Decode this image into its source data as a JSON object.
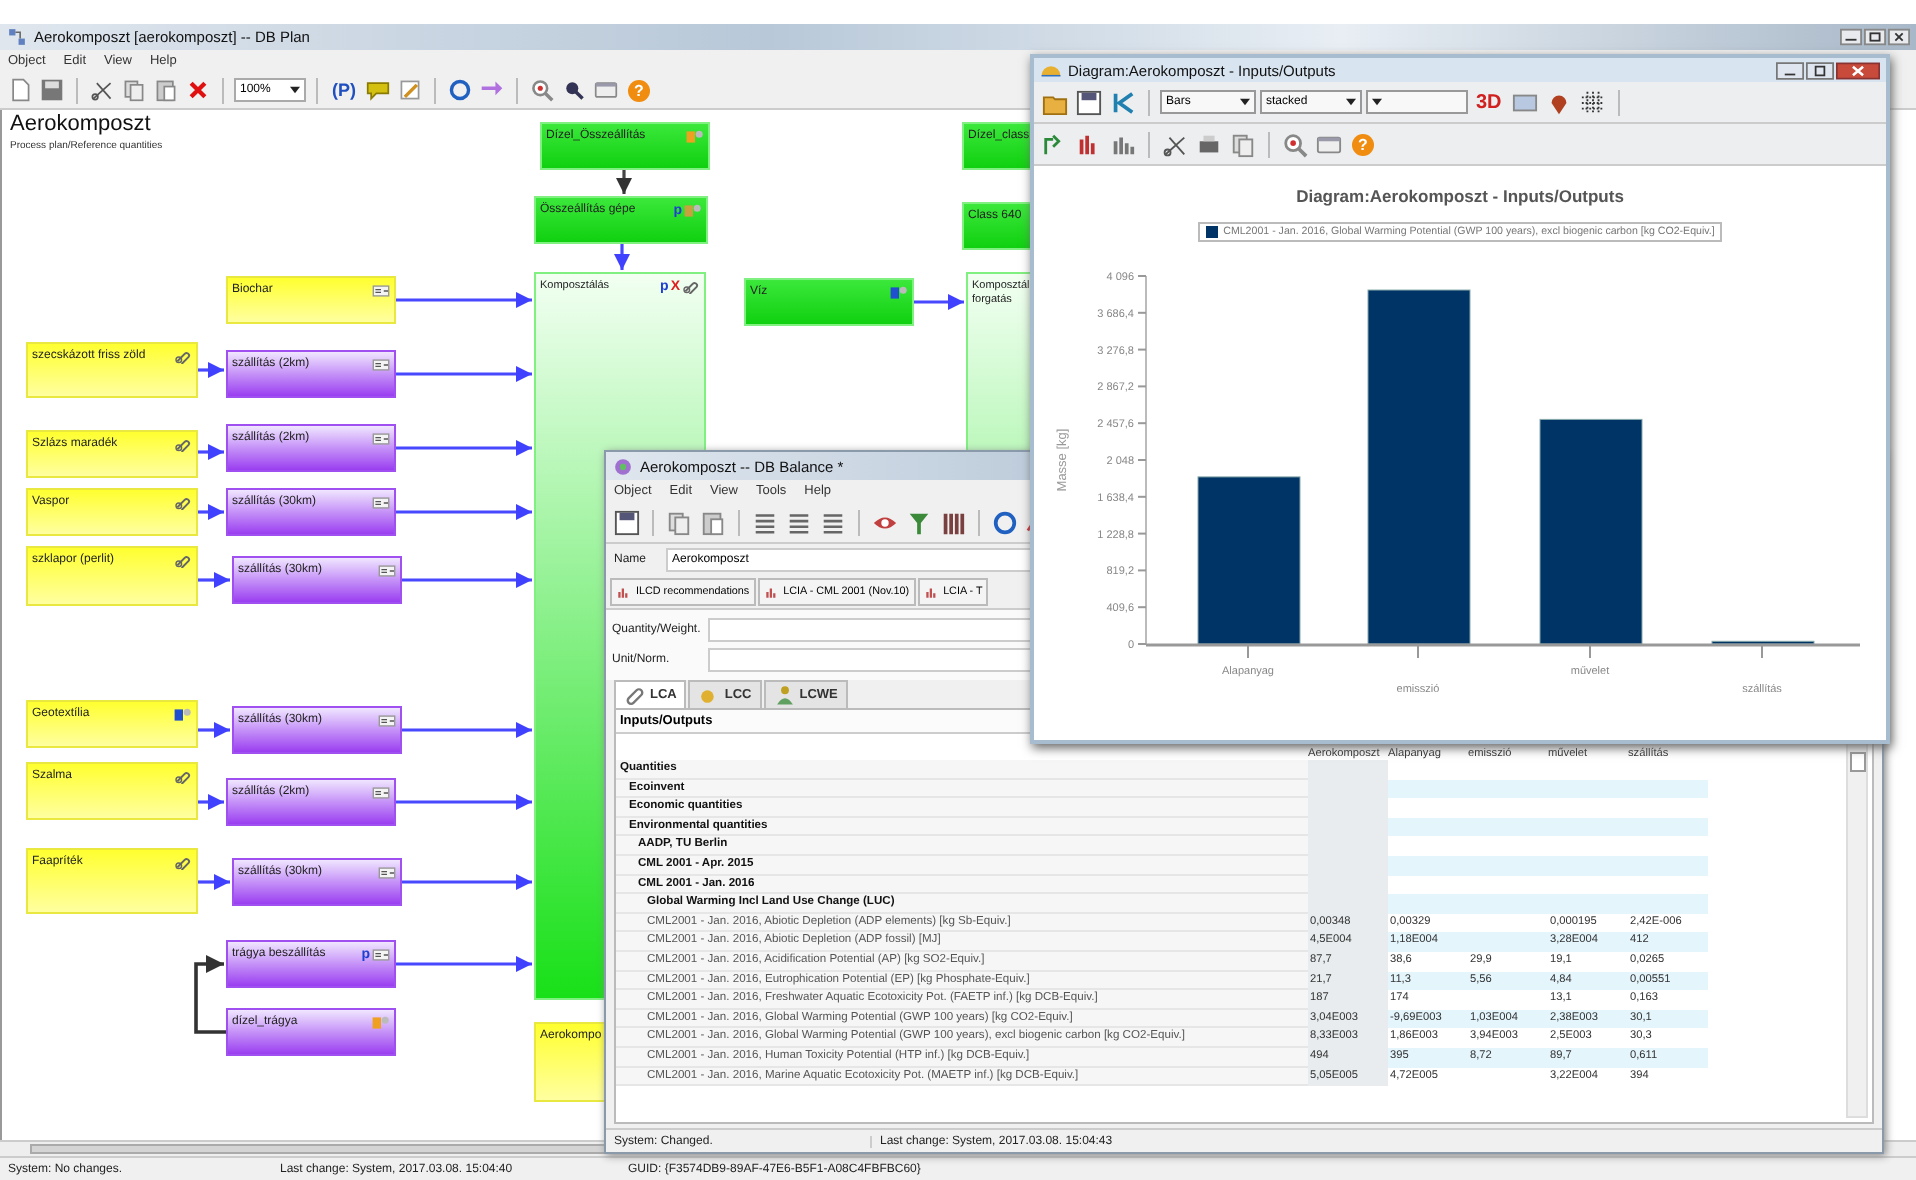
{
  "main_window": {
    "title": "Aerokomposzt [aerokomposzt] -- DB Plan",
    "menu": [
      "Object",
      "Edit",
      "View",
      "Help"
    ],
    "zoom": "100%",
    "p_button": "(P)",
    "help": "?"
  },
  "plan": {
    "title": "Aerokomposzt",
    "subtitle": "Process plan/Reference quantities",
    "nodes": [
      {
        "label": "Dízel_Összeállítás",
        "kind": "green",
        "marks": [
          {
            "kind": "doc",
            "color": "#f0a020"
          }
        ]
      },
      {
        "label": "Összeállítás gépe",
        "kind": "green",
        "marks": [
          {
            "kind": "letter",
            "text": "p",
            "color": "#2040d0"
          },
          {
            "kind": "doc",
            "color": "#c8a040"
          }
        ]
      },
      {
        "label": "Komposztálás",
        "kind": "green-tall",
        "marks": [
          {
            "kind": "letter",
            "text": "p",
            "color": "#2040d0"
          },
          {
            "kind": "letter",
            "text": "X",
            "color": "#e02020"
          },
          {
            "kind": "link"
          }
        ]
      },
      {
        "label": "Víz",
        "kind": "green",
        "marks": [
          {
            "kind": "doc",
            "color": "#2050d0"
          }
        ]
      },
      {
        "label": "Dízel_class",
        "kind": "green"
      },
      {
        "label": "Class 640",
        "kind": "green"
      },
      {
        "label": "Komposztál forgatás",
        "kind": "green-tall"
      },
      {
        "label": "Aerokompo",
        "kind": "yellow"
      },
      {
        "label": "Biochar",
        "kind": "yellow",
        "marks": [
          {
            "kind": "flow"
          }
        ]
      },
      {
        "label": "szecskázott friss zöld",
        "kind": "yellow",
        "marks": [
          {
            "kind": "link"
          }
        ]
      },
      {
        "label": "Szlázs maradék",
        "kind": "yellow",
        "marks": [
          {
            "kind": "link"
          }
        ]
      },
      {
        "label": "Vaspor",
        "kind": "yellow",
        "marks": [
          {
            "kind": "link"
          }
        ]
      },
      {
        "label": "szklapor (perlit)",
        "kind": "yellow",
        "marks": [
          {
            "kind": "link"
          }
        ]
      },
      {
        "label": "Geotextília",
        "kind": "yellow",
        "marks": [
          {
            "kind": "doc",
            "color": "#2050d0"
          }
        ]
      },
      {
        "label": "Szalma",
        "kind": "yellow",
        "marks": [
          {
            "kind": "link"
          }
        ]
      },
      {
        "label": "Faapríték",
        "kind": "yellow",
        "marks": [
          {
            "kind": "link"
          }
        ]
      },
      {
        "label": "szállítás (2km)",
        "kind": "purple",
        "marks": [
          {
            "kind": "flow"
          }
        ]
      },
      {
        "label": "szállítás (2km)",
        "kind": "purple",
        "marks": [
          {
            "kind": "flow"
          }
        ]
      },
      {
        "label": "szállítás (30km)",
        "kind": "purple",
        "marks": [
          {
            "kind": "flow"
          }
        ]
      },
      {
        "label": "szállítás (30km)",
        "kind": "purple",
        "marks": [
          {
            "kind": "flow"
          }
        ]
      },
      {
        "label": "szállítás (30km)",
        "kind": "purple",
        "marks": [
          {
            "kind": "flow"
          }
        ]
      },
      {
        "label": "szállítás (2km)",
        "kind": "purple",
        "marks": [
          {
            "kind": "flow"
          }
        ]
      },
      {
        "label": "szállítás (30km)",
        "kind": "purple",
        "marks": [
          {
            "kind": "flow"
          }
        ]
      },
      {
        "label": "trágya beszállítás",
        "kind": "purple",
        "marks": [
          {
            "kind": "letter",
            "text": "p",
            "color": "#2040d0"
          },
          {
            "kind": "flow"
          }
        ]
      },
      {
        "label": "dízel_trágya",
        "kind": "purple",
        "marks": [
          {
            "kind": "doc",
            "color": "#f0a020"
          }
        ]
      }
    ]
  },
  "status_bar": [
    "System: No changes.",
    "Last change: System, 2017.03.08. 15:04:40",
    "GUID: {F3574DB9-89AF-47E6-B5F1-A08C4FBFBC60}"
  ],
  "balance_window": {
    "title": "Aerokomposzt -- DB Balance *",
    "menu": [
      "Object",
      "Edit",
      "View",
      "Tools",
      "Help"
    ],
    "name_label": "Name",
    "name_value": "Aerokomposzt",
    "method_tabs": [
      "ILCD recommendations",
      "LCIA - CML 2001 (Nov.10)",
      "LCIA - T"
    ],
    "fields": [
      "Quantity/Weight.",
      "Unit/Norm."
    ],
    "tabs": [
      {
        "label": "LCA",
        "selected": true
      },
      {
        "label": "LCC",
        "selected": false
      },
      {
        "label": "LCWE",
        "selected": false
      }
    ],
    "table": {
      "header": "Inputs/Outputs",
      "columns": [
        "Aerokomposzt",
        "Alapanyag",
        "emisszió",
        "művelet",
        "szállítás"
      ],
      "rows": [
        {
          "label": "Quantities",
          "kind": "group",
          "children": [
            {
              "label": "Ecoinvent",
              "kind": "group"
            },
            {
              "label": "Economic quantities",
              "kind": "group"
            },
            {
              "label": "Environmental quantities",
              "kind": "group",
              "children": [
                {
                  "label": "AADP, TU Berlin",
                  "kind": "group"
                },
                {
                  "label": "CML 2001 - Apr. 2015",
                  "kind": "group"
                },
                {
                  "label": "CML 2001 - Jan. 2016",
                  "kind": "group",
                  "children": [
                    {
                      "label": "Global Warming Incl Land Use Change (LUC)",
                      "kind": "group"
                    },
                    {
                      "label": "CML2001 - Jan. 2016, Abiotic Depletion (ADP elements) [kg Sb-Equiv.]",
                      "kind": "value",
                      "values": {
                        "col_1": "0,00348",
                        "col_2": "0,00329",
                        "col_4": "0,000195",
                        "col_5": "2,42E-006"
                      }
                    },
                    {
                      "label": "CML2001 - Jan. 2016, Abiotic Depletion (ADP fossil) [MJ]",
                      "kind": "value",
                      "values": {
                        "col_1": "4,5E004",
                        "col_2": "1,18E004",
                        "col_4": "3,28E004",
                        "col_5": "412"
                      }
                    },
                    {
                      "label": "CML2001 - Jan. 2016, Acidification Potential (AP) [kg SO2-Equiv.]",
                      "kind": "value",
                      "values": {
                        "col_1": "87,7",
                        "col_2": "38,6",
                        "col_3": "29,9",
                        "col_4": "19,1",
                        "col_5": "0,0265"
                      }
                    },
                    {
                      "label": "CML2001 - Jan. 2016, Eutrophication Potential (EP) [kg Phosphate-Equiv.]",
                      "kind": "value",
                      "values": {
                        "col_1": "21,7",
                        "col_2": "11,3",
                        "col_3": "5,56",
                        "col_4": "4,84",
                        "col_5": "0,00551"
                      }
                    },
                    {
                      "label": "CML2001 - Jan. 2016, Freshwater Aquatic Ecotoxicity Pot. (FAETP inf.) [kg DCB-Equiv.]",
                      "kind": "value",
                      "values": {
                        "col_1": "187",
                        "col_2": "174",
                        "col_4": "13,1",
                        "col_5": "0,163"
                      }
                    },
                    {
                      "label": "CML2001 - Jan. 2016, Global Warming Potential (GWP 100 years) [kg CO2-Equiv.]",
                      "kind": "value",
                      "values": {
                        "col_1": "3,04E003",
                        "col_2": "-9,69E003",
                        "col_3": "1,03E004",
                        "col_4": "2,38E003",
                        "col_5": "30,1"
                      }
                    },
                    {
                      "label": "CML2001 - Jan. 2016, Global Warming Potential (GWP 100 years), excl biogenic carbon [kg CO2-Equiv.]",
                      "kind": "value",
                      "values": {
                        "col_1": "8,33E003",
                        "col_2": "1,86E003",
                        "col_3": "3,94E003",
                        "col_4": "2,5E003",
                        "col_5": "30,3"
                      }
                    },
                    {
                      "label": "CML2001 - Jan. 2016, Human Toxicity Potential (HTP inf.) [kg DCB-Equiv.]",
                      "kind": "value",
                      "values": {
                        "col_1": "494",
                        "col_2": "395",
                        "col_3": "8,72",
                        "col_4": "89,7",
                        "col_5": "0,611"
                      }
                    },
                    {
                      "label": "CML2001 - Jan. 2016, Marine Aquatic Ecotoxicity Pot. (MAETP inf.) [kg DCB-Equiv.]",
                      "kind": "value",
                      "values": {
                        "col_1": "5,05E005",
                        "col_2": "4,72E005",
                        "col_4": "3,22E004",
                        "col_5": "394"
                      }
                    }
                  ]
                }
              ]
            }
          ]
        }
      ]
    },
    "status_bar": [
      "System: Changed.",
      "Last change: System, 2017.03.08. 15:04:43"
    ]
  },
  "diagram_window": {
    "title": "Diagram:Aerokomposzt - Inputs/Outputs",
    "chart_type": "Bars",
    "mode": "stacked",
    "three_d": "3D",
    "help": "?",
    "chart_data": {
      "type": "bar",
      "title": "Diagram:Aerokomposzt - Inputs/Outputs",
      "ylabel": "Masse [kg]",
      "categories": [
        "Alapanyag",
        "emisszió",
        "művelet",
        "szállítás"
      ],
      "series": [
        {
          "name": "CML2001 - Jan. 2016, Global Warming Potential (GWP 100 years), excl biogenic carbon [kg CO2-Equiv.]",
          "color": "#003366",
          "values": [
            1860,
            3940,
            2500,
            30
          ]
        }
      ],
      "ylim": [
        0,
        4096
      ],
      "yticks": [
        {
          "value": 0,
          "label": "0"
        },
        {
          "value": 409.6,
          "label": "409,6"
        },
        {
          "value": 819.2,
          "label": "819,2"
        },
        {
          "value": 1228.8,
          "label": "1 228,8"
        },
        {
          "value": 1638.4,
          "label": "1 638,4"
        },
        {
          "value": 2048,
          "label": "2 048"
        },
        {
          "value": 2457.6,
          "label": "2 457,6"
        },
        {
          "value": 2867.2,
          "label": "2 867,2"
        },
        {
          "value": 3276.8,
          "label": "3 276,8"
        },
        {
          "value": 3686.4,
          "label": "3 686,4"
        },
        {
          "value": 4096,
          "label": "4 096"
        }
      ]
    }
  }
}
